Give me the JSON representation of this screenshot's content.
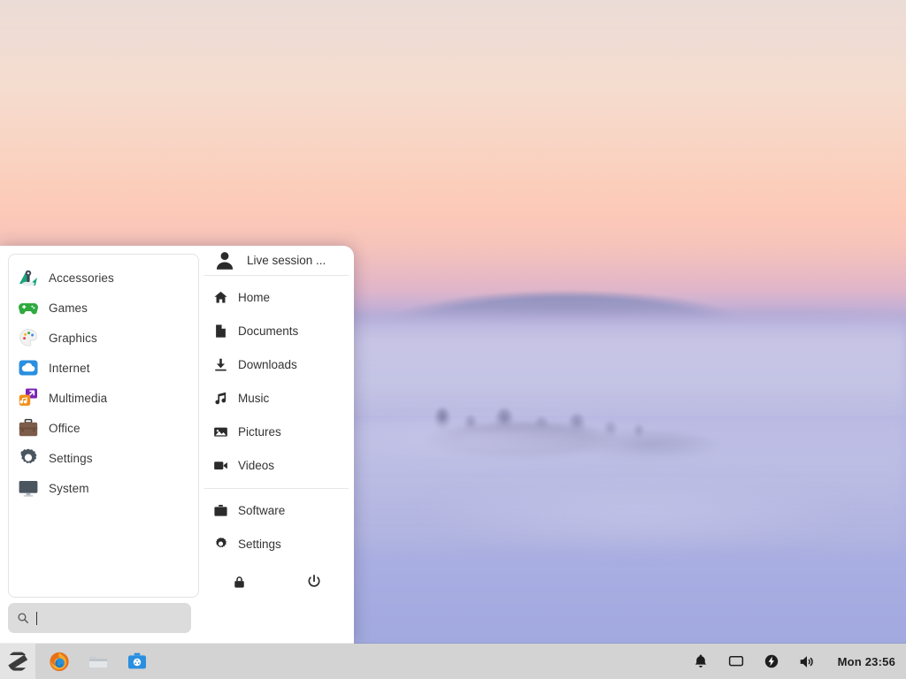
{
  "desktop": {
    "wallpaper_name": "misty-mountain-sunrise",
    "colors": {
      "sky_top": "#ecdcd7",
      "sky_mid": "#fbcfbd",
      "sky_low": "#bcaad8",
      "fog": "#b5b4e2",
      "ridge": "#8a8cb8",
      "forest": "#4a4a72"
    }
  },
  "menu": {
    "categories": [
      {
        "label": "Accessories",
        "icon": "accessories-icon"
      },
      {
        "label": "Games",
        "icon": "games-icon"
      },
      {
        "label": "Graphics",
        "icon": "graphics-icon"
      },
      {
        "label": "Internet",
        "icon": "internet-icon"
      },
      {
        "label": "Multimedia",
        "icon": "multimedia-icon"
      },
      {
        "label": "Office",
        "icon": "office-icon"
      },
      {
        "label": "Settings",
        "icon": "settings-icon"
      },
      {
        "label": "System",
        "icon": "system-icon"
      }
    ],
    "search": {
      "value": "",
      "placeholder": "",
      "icon": "search-icon"
    },
    "user": {
      "label": "Live session ...",
      "icon": "user-avatar-icon"
    },
    "places": [
      {
        "label": "Home",
        "icon": "home-icon"
      },
      {
        "label": "Documents",
        "icon": "document-icon"
      },
      {
        "label": "Downloads",
        "icon": "download-icon"
      },
      {
        "label": "Music",
        "icon": "music-note-icon"
      },
      {
        "label": "Pictures",
        "icon": "picture-icon"
      },
      {
        "label": "Videos",
        "icon": "video-camera-icon"
      }
    ],
    "system": [
      {
        "label": "Software",
        "icon": "briefcase-icon"
      },
      {
        "label": "Settings",
        "icon": "gear-icon"
      }
    ],
    "actions": [
      {
        "name": "lock-button",
        "icon": "lock-icon"
      },
      {
        "name": "power-button",
        "icon": "power-icon"
      }
    ]
  },
  "taskbar": {
    "start_button": {
      "name": "start-menu-button",
      "icon": "zorin-logo-icon"
    },
    "launchers": [
      {
        "name": "firefox",
        "icon": "firefox-icon"
      },
      {
        "name": "file-manager",
        "icon": "folder-icon"
      },
      {
        "name": "software-center",
        "icon": "software-center-icon"
      }
    ],
    "tray": [
      {
        "name": "notifications",
        "icon": "bell-icon"
      },
      {
        "name": "display",
        "icon": "monitor-icon"
      },
      {
        "name": "power-status",
        "icon": "battery-charging-icon"
      },
      {
        "name": "volume",
        "icon": "speaker-icon"
      }
    ],
    "clock": "Mon 23:56",
    "background": "#d3d3d3"
  }
}
